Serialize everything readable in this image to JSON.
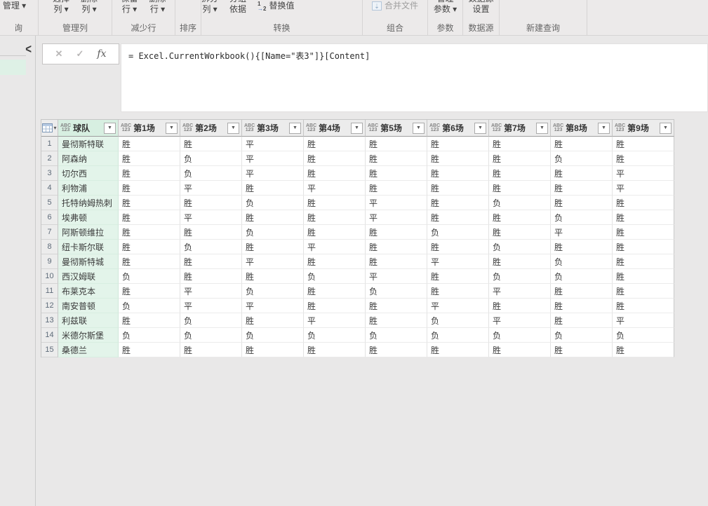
{
  "icons": {
    "cancel": "✕",
    "check": "✓",
    "fx": "fx",
    "chevron_collapse": "<",
    "dropdown_arrow": "▾",
    "filter_arrow": "▼",
    "replace_values_top": "1",
    "replace_values_arrow": "→",
    "replace_values_bottom": "2",
    "combine_files_glyph": "⇣"
  },
  "colors": {
    "selected_column_header": "#d7efe1",
    "selected_column_cell": "#e3f4ea",
    "ribbon_bg": "#eceaea",
    "content_bg": "#e9e8e8"
  },
  "ribbon": {
    "groups": [
      {
        "id": "query",
        "label": "查询",
        "buttons": [
          {
            "id": "manage-query",
            "line1": "",
            "line2": "管理 ▾",
            "style": "single",
            "clip_left": true
          }
        ]
      },
      {
        "id": "manage-columns",
        "label": "管理列",
        "buttons": [
          {
            "id": "choose-columns",
            "line1": "选择",
            "line2": "列 ▾",
            "style": "tall"
          },
          {
            "id": "remove-columns",
            "line1": "删除",
            "line2": "列 ▾",
            "style": "tall"
          }
        ]
      },
      {
        "id": "reduce-rows",
        "label": "减少行",
        "buttons": [
          {
            "id": "keep-rows",
            "line1": "保留",
            "line2": "行 ▾",
            "style": "tall"
          },
          {
            "id": "remove-rows",
            "line1": "删除",
            "line2": "行 ▾",
            "style": "tall"
          }
        ]
      },
      {
        "id": "sort",
        "label": "排序",
        "buttons": []
      },
      {
        "id": "transform",
        "label": "转换",
        "buttons": [
          {
            "id": "split-column",
            "line1": "拆分",
            "line2": "列 ▾",
            "style": "tall"
          },
          {
            "id": "group-by",
            "line1": "分组",
            "line2": "依据",
            "style": "tall"
          },
          {
            "id": "replace-values",
            "line1": "",
            "line2": "替换值",
            "style": "single",
            "icon": "replace-values-icon"
          }
        ]
      },
      {
        "id": "combine",
        "label": "组合",
        "buttons": [
          {
            "id": "combine-files",
            "line1": "",
            "line2": "合并文件",
            "style": "single",
            "icon": "combine-files-icon",
            "disabled": true
          }
        ]
      },
      {
        "id": "parameters",
        "label": "参数",
        "buttons": [
          {
            "id": "manage-parameters",
            "line1": "管理",
            "line2": "参数 ▾",
            "style": "tall"
          }
        ]
      },
      {
        "id": "data-sources",
        "label": "数据源",
        "buttons": [
          {
            "id": "data-source-settings",
            "line1": "数据源",
            "line2": "设置",
            "style": "tall"
          }
        ]
      },
      {
        "id": "new-query",
        "label": "新建查询",
        "buttons": []
      }
    ]
  },
  "formula_bar": {
    "formula": "= Excel.CurrentWorkbook(){[Name=\"表3\"]}[Content]"
  },
  "table": {
    "columns": [
      {
        "id": "team",
        "name": "球队",
        "type": "ABC/123",
        "selected": true
      },
      {
        "id": "match1",
        "name": "第1场",
        "type": "ABC/123"
      },
      {
        "id": "match2",
        "name": "第2场",
        "type": "ABC/123"
      },
      {
        "id": "match3",
        "name": "第3场",
        "type": "ABC/123"
      },
      {
        "id": "match4",
        "name": "第4场",
        "type": "ABC/123"
      },
      {
        "id": "match5",
        "name": "第5场",
        "type": "ABC/123"
      },
      {
        "id": "match6",
        "name": "第6场",
        "type": "ABC/123"
      },
      {
        "id": "match7",
        "name": "第7场",
        "type": "ABC/123"
      },
      {
        "id": "match8",
        "name": "第8场",
        "type": "ABC/123"
      },
      {
        "id": "match9",
        "name": "第9场",
        "type": "ABC/123"
      }
    ],
    "rows": [
      {
        "num": 1,
        "team": "曼彻斯特联",
        "results": [
          "胜",
          "胜",
          "平",
          "胜",
          "胜",
          "胜",
          "胜",
          "胜",
          "胜"
        ]
      },
      {
        "num": 2,
        "team": "阿森纳",
        "results": [
          "胜",
          "负",
          "平",
          "胜",
          "胜",
          "胜",
          "胜",
          "负",
          "胜"
        ]
      },
      {
        "num": 3,
        "team": "切尔西",
        "results": [
          "胜",
          "负",
          "平",
          "胜",
          "胜",
          "胜",
          "胜",
          "胜",
          "平"
        ]
      },
      {
        "num": 4,
        "team": "利物浦",
        "results": [
          "胜",
          "平",
          "胜",
          "平",
          "胜",
          "胜",
          "胜",
          "胜",
          "平"
        ]
      },
      {
        "num": 5,
        "team": "托特纳姆热刺",
        "results": [
          "胜",
          "胜",
          "负",
          "胜",
          "平",
          "胜",
          "负",
          "胜",
          "胜"
        ]
      },
      {
        "num": 6,
        "team": "埃弗顿",
        "results": [
          "胜",
          "平",
          "胜",
          "胜",
          "平",
          "胜",
          "胜",
          "负",
          "胜"
        ]
      },
      {
        "num": 7,
        "team": "阿斯顿维拉",
        "results": [
          "胜",
          "胜",
          "负",
          "胜",
          "胜",
          "负",
          "胜",
          "平",
          "胜"
        ]
      },
      {
        "num": 8,
        "team": "纽卡斯尔联",
        "results": [
          "胜",
          "负",
          "胜",
          "平",
          "胜",
          "胜",
          "负",
          "胜",
          "胜"
        ]
      },
      {
        "num": 9,
        "team": "曼彻斯特城",
        "results": [
          "胜",
          "胜",
          "平",
          "胜",
          "胜",
          "平",
          "胜",
          "负",
          "胜"
        ]
      },
      {
        "num": 10,
        "team": "西汉姆联",
        "results": [
          "负",
          "胜",
          "胜",
          "负",
          "平",
          "胜",
          "负",
          "负",
          "胜"
        ]
      },
      {
        "num": 11,
        "team": "布莱克本",
        "results": [
          "胜",
          "平",
          "负",
          "胜",
          "负",
          "胜",
          "平",
          "胜",
          "胜"
        ]
      },
      {
        "num": 12,
        "team": "南安普顿",
        "results": [
          "负",
          "平",
          "平",
          "胜",
          "胜",
          "平",
          "胜",
          "胜",
          "胜"
        ]
      },
      {
        "num": 13,
        "team": "利兹联",
        "results": [
          "胜",
          "负",
          "胜",
          "平",
          "胜",
          "负",
          "平",
          "胜",
          "平"
        ]
      },
      {
        "num": 14,
        "team": "米德尔斯堡",
        "results": [
          "负",
          "负",
          "负",
          "负",
          "负",
          "负",
          "负",
          "负",
          "负"
        ]
      },
      {
        "num": 15,
        "team": "桑德兰",
        "results": [
          "胜",
          "胜",
          "胜",
          "胜",
          "胜",
          "胜",
          "胜",
          "胜",
          "胜"
        ]
      }
    ]
  }
}
